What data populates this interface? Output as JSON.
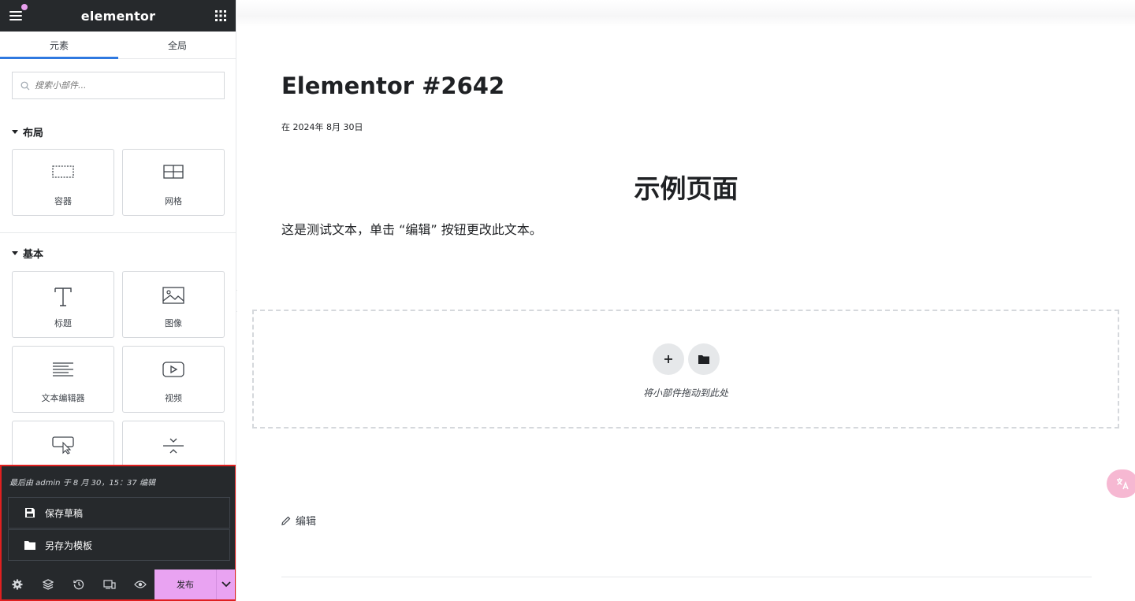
{
  "topbar": {
    "logo": "elementor"
  },
  "tabs": [
    {
      "label": "元素",
      "active": true
    },
    {
      "label": "全局",
      "active": false
    }
  ],
  "search": {
    "placeholder": "搜索小部件..."
  },
  "categories": {
    "layout": {
      "title": "布局",
      "widgets": [
        {
          "label": "容器",
          "icon": "container-icon"
        },
        {
          "label": "网格",
          "icon": "grid-icon"
        }
      ]
    },
    "basic": {
      "title": "基本",
      "widgets": [
        {
          "label": "标题",
          "icon": "heading-icon"
        },
        {
          "label": "图像",
          "icon": "image-icon"
        },
        {
          "label": "文本编辑器",
          "icon": "text-editor-icon"
        },
        {
          "label": "视频",
          "icon": "video-icon"
        },
        {
          "label": "",
          "icon": "button-icon"
        },
        {
          "label": "",
          "icon": "divider-icon"
        }
      ]
    }
  },
  "footer": {
    "last_edited": "最后由 admin 于 8 月 30，15：37 编辑",
    "save_draft": "保存草稿",
    "save_template": "另存为模板",
    "publish": "发布"
  },
  "page": {
    "post_title": "Elementor #2642",
    "post_date": "在 2024年 8月 30日",
    "heading": "示例页面",
    "paragraph": "这是测试文本，单击 “编辑” 按钮更改此文本。",
    "drop_text": "将小部件拖动到此处",
    "edit_link": "编辑"
  },
  "colors": {
    "accent": "#2f79e0",
    "publish_bg": "#e9a3f2",
    "dark_panel": "#26292c",
    "highlight_border": "#e02020"
  }
}
